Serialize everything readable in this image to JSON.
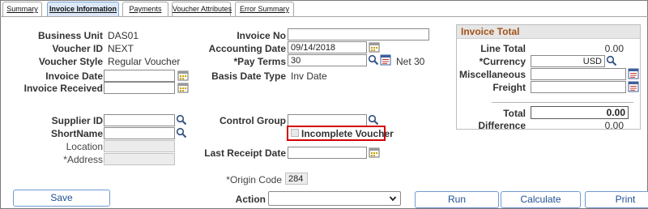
{
  "tabs": [
    {
      "label": "Summary"
    },
    {
      "label": "Invoice Information"
    },
    {
      "label": "Payments"
    },
    {
      "label": "Voucher Attributes"
    },
    {
      "label": "Error Summary"
    }
  ],
  "header": {
    "business_unit_label": "Business Unit",
    "business_unit_value": "DAS01",
    "voucher_id_label": "Voucher ID",
    "voucher_id_value": "NEXT",
    "voucher_style_label": "Voucher Style",
    "voucher_style_value": "Regular Voucher",
    "invoice_date_label": "Invoice Date",
    "invoice_date_value": "",
    "invoice_received_label": "Invoice Received",
    "invoice_received_value": ""
  },
  "invoice": {
    "invoice_no_label": "Invoice No",
    "invoice_no_value": "",
    "accounting_date_label": "Accounting Date",
    "accounting_date_value": "09/14/2018",
    "pay_terms_label": "*Pay Terms",
    "pay_terms_value": "30",
    "pay_terms_desc": "Net 30",
    "basis_date_type_label": "Basis Date Type",
    "basis_date_type_value": "Inv Date"
  },
  "supplier": {
    "supplier_id_label": "Supplier ID",
    "supplier_id_value": "",
    "shortname_label": "ShortName",
    "shortname_value": "",
    "location_label": "Location",
    "location_value": "",
    "address_label": "*Address",
    "address_value": ""
  },
  "control": {
    "control_group_label": "Control Group",
    "control_group_value": "",
    "incomplete_voucher_label": "Incomplete Voucher",
    "incomplete_voucher_checked": false,
    "last_receipt_date_label": "Last Receipt Date",
    "last_receipt_date_value": "",
    "origin_code_label": "*Origin Code",
    "origin_code_value": "284"
  },
  "invoice_total": {
    "title": "Invoice Total",
    "line_total_label": "Line Total",
    "line_total_value": "0.00",
    "currency_label": "*Currency",
    "currency_value": "USD",
    "misc_label": "Miscellaneous",
    "misc_value": "",
    "freight_label": "Freight",
    "freight_value": "",
    "total_label": "Total",
    "total_value": "0.00",
    "difference_label": "Difference",
    "difference_value": "0.00"
  },
  "actions": {
    "save_label": "Save",
    "action_label": "Action",
    "action_selected": "",
    "run_label": "Run",
    "calculate_label": "Calculate",
    "print_label": "Print"
  },
  "icon_names": [
    "calendar-icon",
    "lookup-icon",
    "detail-icon",
    "chevron-down-icon"
  ],
  "colors": {
    "accent_blue": "#1f4f93",
    "active_tab_bg": "#dce8f8",
    "panel_title": "#a35317",
    "highlight_red": "#d10000"
  }
}
